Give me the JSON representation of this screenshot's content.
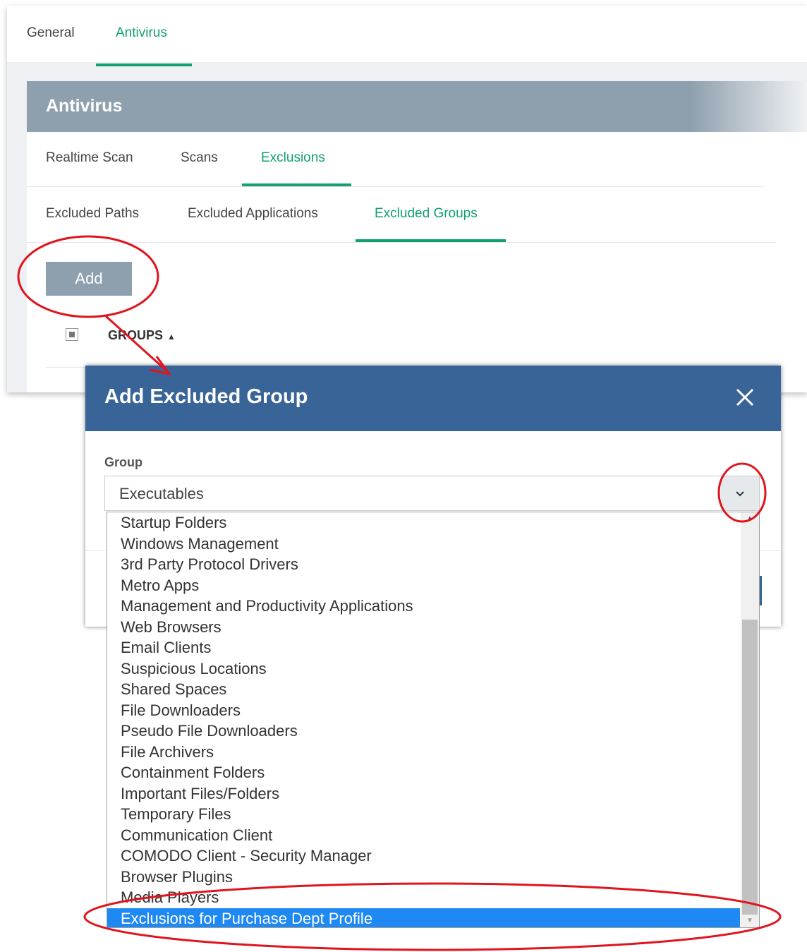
{
  "top_tabs": [
    {
      "label": "General"
    },
    {
      "label": "Antivirus",
      "active": true
    }
  ],
  "card": {
    "title": "Antivirus",
    "tabs": [
      {
        "label": "Realtime Scan"
      },
      {
        "label": "Scans"
      },
      {
        "label": "Exclusions",
        "active": true
      }
    ],
    "subtabs": [
      {
        "label": "Excluded Paths"
      },
      {
        "label": "Excluded Applications"
      },
      {
        "label": "Excluded Groups",
        "active": true
      }
    ],
    "add_label": "Add",
    "table_header": "GROUPS",
    "sort_icon": "▲"
  },
  "dialog": {
    "title": "Add Excluded Group",
    "close_icon": "close-icon",
    "field_label": "Group",
    "selected_value": "Executables",
    "options": [
      "Startup Folders",
      "Windows Management",
      "3rd Party Protocol Drivers",
      "Metro Apps",
      "Management and Productivity Applications",
      "Web Browsers",
      "Email Clients",
      "Suspicious Locations",
      "Shared Spaces",
      "File Downloaders",
      "Pseudo File Downloaders",
      "File Archivers",
      "Containment Folders",
      "Important Files/Folders",
      "Temporary Files",
      "Communication Client",
      "COMODO Client - Security Manager",
      "Browser Plugins",
      "Media Players",
      "Exclusions for Purchase Dept Profile"
    ],
    "highlighted_option": "Exclusions for Purchase Dept Profile"
  },
  "colors": {
    "accent_green": "#12a06e",
    "header_gray": "#8e9fad",
    "dialog_blue": "#396497",
    "highlight_blue": "#1e88f3",
    "annotation_red": "#e0141e"
  }
}
